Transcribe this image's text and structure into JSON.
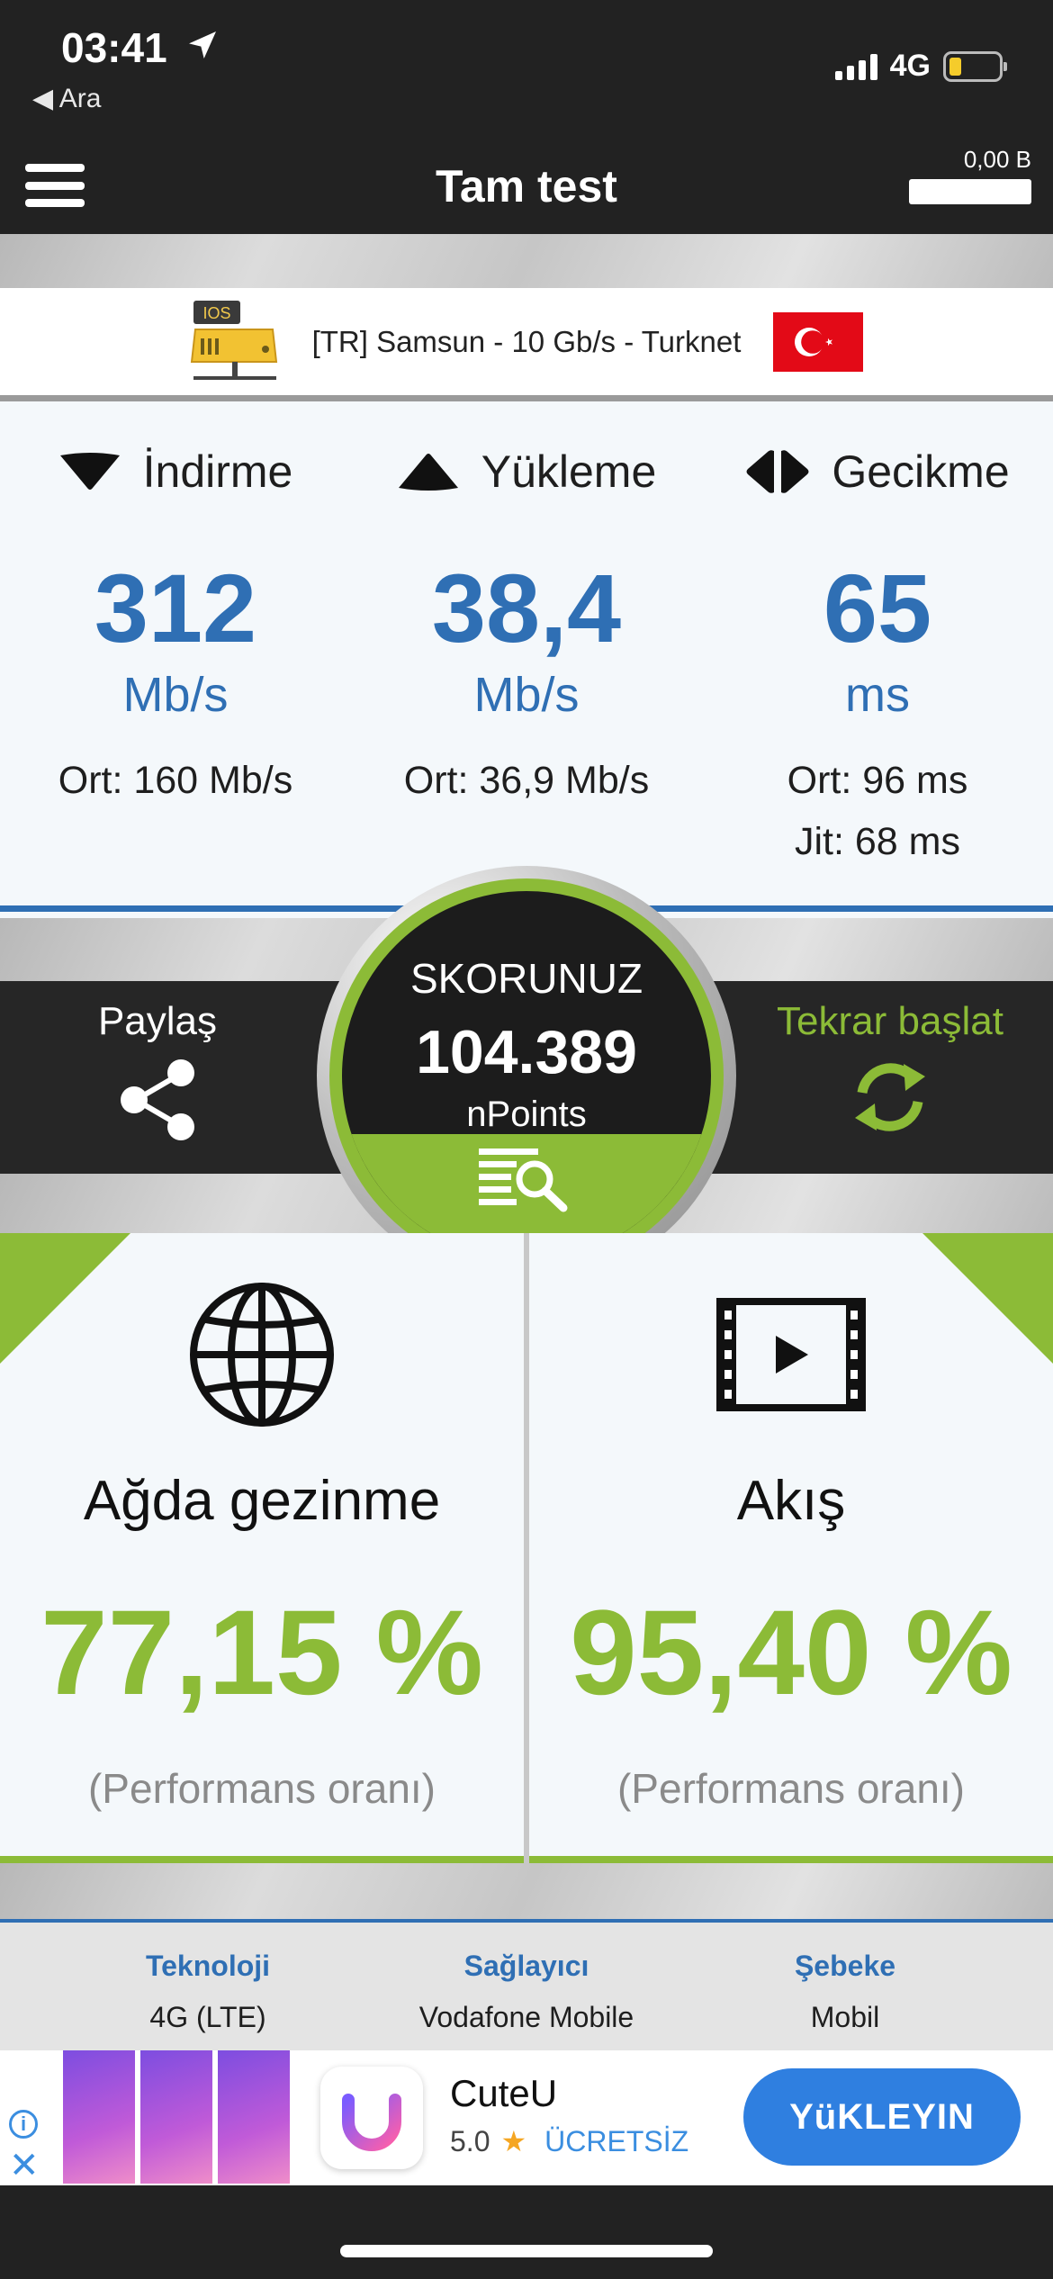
{
  "status_bar": {
    "time": "03:41",
    "back_label": "Ara",
    "network": "4G",
    "battery_level": 0.25
  },
  "header": {
    "title": "Tam test",
    "data_used": "0,00 B"
  },
  "server": {
    "badge": "IOS",
    "name": "[TR] Samsun - 10 Gb/s - Turknet"
  },
  "metrics": {
    "download": {
      "label": "İndirme",
      "value": "312",
      "unit": "Mb/s",
      "avg": "Ort: 160 Mb/s"
    },
    "upload": {
      "label": "Yükleme",
      "value": "38,4",
      "unit": "Mb/s",
      "avg": "Ort: 36,9 Mb/s"
    },
    "latency": {
      "label": "Gecikme",
      "value": "65",
      "unit": "ms",
      "avg": "Ort: 96 ms",
      "jitter": "Jit: 68 ms"
    }
  },
  "score": {
    "share_label": "Paylaş",
    "title": "SKORUNUZ",
    "value": "104.389",
    "unit": "nPoints",
    "restart_label": "Tekrar başlat"
  },
  "performance": {
    "browsing": {
      "name": "Ağda gezinme",
      "value": "77,15 %",
      "caption": "(Performans oranı)"
    },
    "streaming": {
      "name": "Akış",
      "value": "95,40 %",
      "caption": "(Performans oranı)"
    }
  },
  "info": [
    {
      "label": "Teknoloji",
      "value": "4G (LTE)"
    },
    {
      "label": "Sağlayıcı",
      "value": "Vodafone Mobile"
    },
    {
      "label": "Şebeke",
      "value": "Mobil"
    }
  ],
  "ad": {
    "app_name": "CuteU",
    "rating": "5.0",
    "price": "ÜCRETSİZ",
    "cta": "YüKLEYIN"
  },
  "colors": {
    "accent_blue": "#2f6fb4",
    "accent_green": "#8cbb37",
    "dark": "#222222"
  }
}
